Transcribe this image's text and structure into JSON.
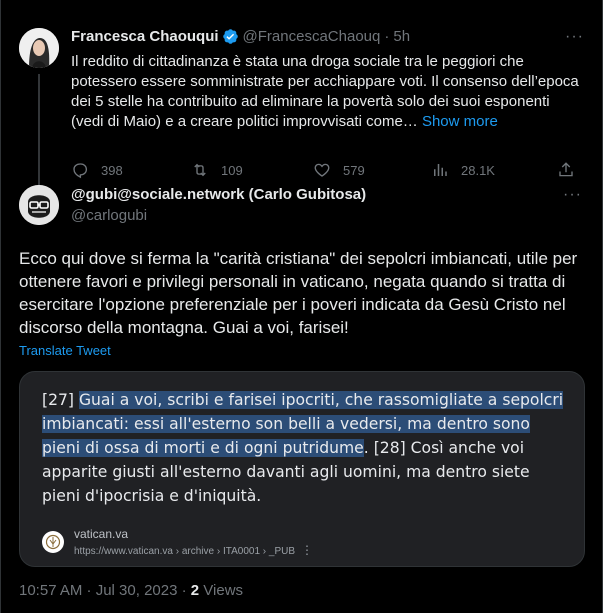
{
  "parent_tweet": {
    "name": "Francesca Chaouqui",
    "handle": "@FrancescaChaouq",
    "separator": "·",
    "time": "5h",
    "text": "Il reddito di cittadinanza è stata una droga sociale tra le peggiori che potessero essere somministrate per acchiappare voti. Il consenso dell’epoca dei 5 stelle ha contribuito ad eliminare la povertà solo dei suoi esponenti (vedi di Maio) e a creare politici improvvisati come…",
    "show_more": "Show more",
    "replies": "398",
    "retweets": "109",
    "likes": "579",
    "views": "28.1K",
    "more": "···"
  },
  "main_tweet": {
    "name": "@gubi@sociale.network (Carlo Gubitosa)",
    "handle": "@carlogubi",
    "more": "···",
    "text": "Ecco qui dove si ferma la \"carità cristiana\" dei sepolcri imbiancati, utile per ottenere favori e privilegi personali in vaticano, negata quando si tratta di esercitare l'opzione preferenziale per i poveri indicata da Gesù Cristo nel discorso della montagna. Guai a voi, farisei!",
    "translate": "Translate Tweet",
    "card": {
      "verse_start": "[27] ",
      "highlighted": "Guai a voi, scribi e farisei ipocriti, che rassomigliate a sepolcri imbiancati: essi all'esterno son belli a vedersi, ma dentro sono pieni di ossa di morti e di ogni putridume",
      "after_highlight": ". [28] Così anche voi apparite giusti all'esterno davanti agli uomini, ma dentro siete pieni d'ipocrisia e d'iniquità.",
      "site_name": "vatican.va",
      "site_url": "https://www.vatican.va › archive › ITA0001 › _PUB",
      "kebab": "⋮"
    },
    "timestamp": "10:57 AM · Jul 30, 2023 · ",
    "views_count": "2",
    "views_label": " Views"
  },
  "colors": {
    "background": "#000000",
    "text": "#e7e9ea",
    "muted": "#71767b",
    "accent": "#1d9bf0",
    "highlight": "#2c4d77",
    "card_bg": "#202124"
  }
}
